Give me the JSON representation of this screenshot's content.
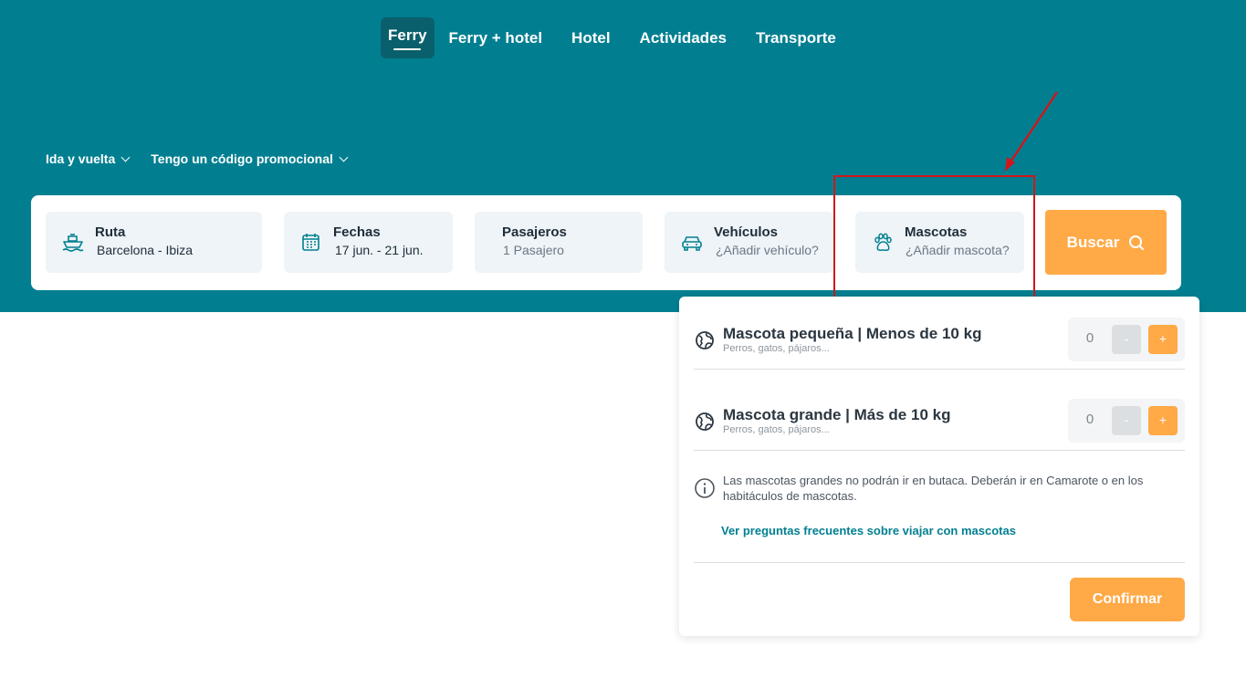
{
  "nav": {
    "tabs": [
      {
        "label": "Ferry",
        "active": true
      },
      {
        "label": "Ferry + hotel"
      },
      {
        "label": "Hotel"
      },
      {
        "label": "Actividades"
      },
      {
        "label": "Transporte"
      }
    ]
  },
  "options": {
    "trip_type": "Ida y vuelta",
    "promo": "Tengo un código promocional"
  },
  "search": {
    "route": {
      "label": "Ruta",
      "value": "Barcelona - Ibiza",
      "icon": "ferry-icon"
    },
    "dates": {
      "label": "Fechas",
      "value": "17 jun. - 21 jun.",
      "icon": "calendar-icon"
    },
    "passengers": {
      "label": "Pasajeros",
      "value": "1 Pasajero"
    },
    "vehicles": {
      "label": "Vehículos",
      "value": "¿Añadir vehículo?",
      "icon": "car-icon"
    },
    "pets": {
      "label": "Mascotas",
      "value": "¿Añadir mascota?",
      "icon": "paw-icon"
    },
    "submit_label": "Buscar"
  },
  "pets_panel": {
    "small": {
      "title": "Mascota pequeña | Menos de 10 kg",
      "subtitle": "Perros, gatos, pájaros...",
      "count": "0",
      "minus": "-",
      "plus": "+"
    },
    "large": {
      "title": "Mascota grande | Más de 10 kg",
      "subtitle": "Perros, gatos, pájaros...",
      "count": "0",
      "minus": "-",
      "plus": "+"
    },
    "info": "Las mascotas grandes no podrán ir en butaca. Deberán ir en Camarote o en los habitáculos de mascotas.",
    "faq_link": "Ver preguntas frecuentes sobre viajar con mascotas",
    "confirm_label": "Confirmar"
  },
  "colors": {
    "brand": "#017f91",
    "accent": "#ffa947",
    "annotation": "#d0171b"
  }
}
